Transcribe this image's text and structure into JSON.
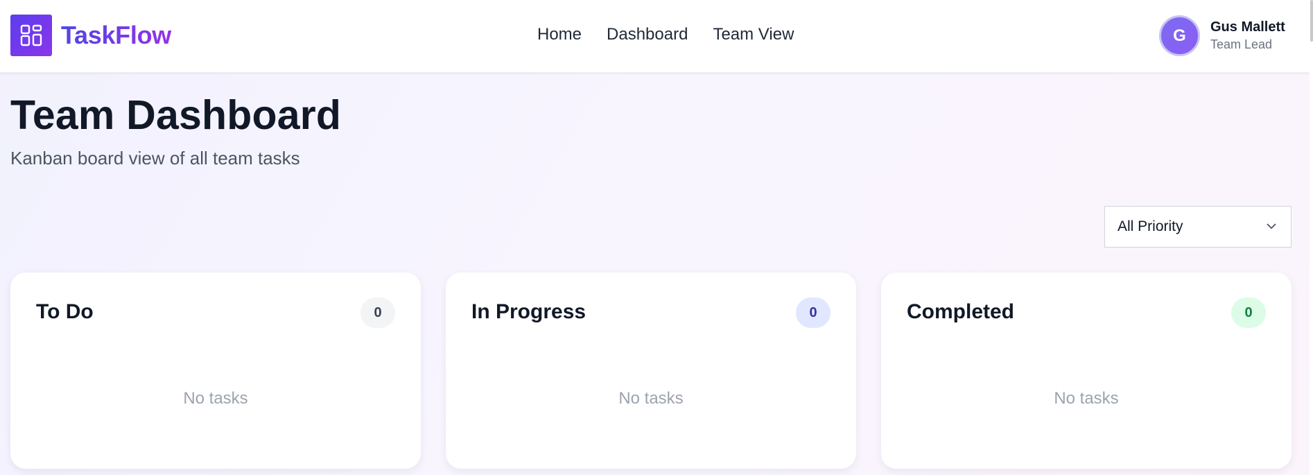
{
  "app": {
    "name": "TaskFlow",
    "brand_gradient": [
      "#4f46e5",
      "#9333ea"
    ],
    "logo_icon": "dashboard-grid-icon"
  },
  "nav": {
    "items": [
      {
        "label": "Home"
      },
      {
        "label": "Dashboard"
      },
      {
        "label": "Team View"
      }
    ]
  },
  "user": {
    "initial": "G",
    "name": "Gus Mallett",
    "role": "Team Lead"
  },
  "page": {
    "title": "Team Dashboard",
    "subtitle": "Kanban board view of all team tasks"
  },
  "filters": {
    "priority": {
      "selected": "All Priority",
      "icon": "chevron-down-icon"
    }
  },
  "columns": [
    {
      "title": "To Do",
      "count": "0",
      "empty_text": "No tasks",
      "badge_color": "#f3f4f6"
    },
    {
      "title": "In Progress",
      "count": "0",
      "empty_text": "No tasks",
      "badge_color": "#e0e7ff"
    },
    {
      "title": "Completed",
      "count": "0",
      "empty_text": "No tasks",
      "badge_color": "#dcfce7"
    }
  ]
}
